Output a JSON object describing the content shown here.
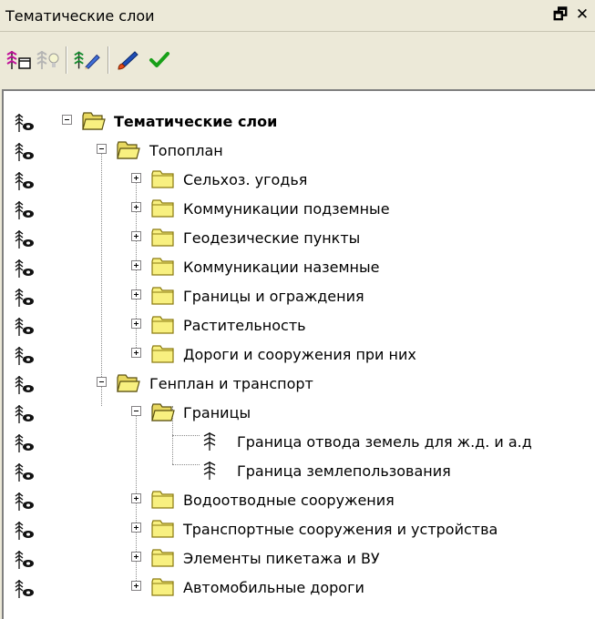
{
  "window": {
    "title": "Тематические слои",
    "float_glyph": "🗗",
    "close_glyph": "✕"
  },
  "toolbar": {
    "tools": [
      {
        "name": "layer-visibility-tool",
        "icon": "tree-visibility-icon"
      },
      {
        "name": "lamp-tool",
        "icon": "lamp-icon"
      },
      {
        "name": "edit-layer-tool",
        "icon": "pencil-layer-icon"
      },
      {
        "name": "brush-tool",
        "icon": "brush-icon"
      },
      {
        "name": "apply-tool",
        "icon": "checkmark-icon"
      }
    ]
  },
  "tree": {
    "root": "Тематические слои",
    "topoplan": "Топоплан",
    "topoplan_items": [
      "Сельхоз. угодья",
      "Коммуникации подземные",
      "Геодезические пункты",
      "Коммуникации наземные",
      "Границы и ограждения",
      "Растительность",
      "Дороги и сооружения при них"
    ],
    "genplan": "Генплан и транспорт",
    "granitsy": "Границы",
    "granitsy_layers": [
      "Граница отвода земель для ж.д. и а.д",
      "Граница землепользования"
    ],
    "genplan_items": [
      "Водоотводные сооружения",
      "Транспортные сооружения  и устройства",
      "Элементы пикетажа и ВУ",
      "Автомобильные дороги"
    ]
  },
  "colors": {
    "folder_fill": "#f8f080",
    "folder_stroke": "#8a7a10",
    "check_green": "#18a018",
    "panel_bg": "#ffffff",
    "chrome_bg": "#ece9d8"
  }
}
